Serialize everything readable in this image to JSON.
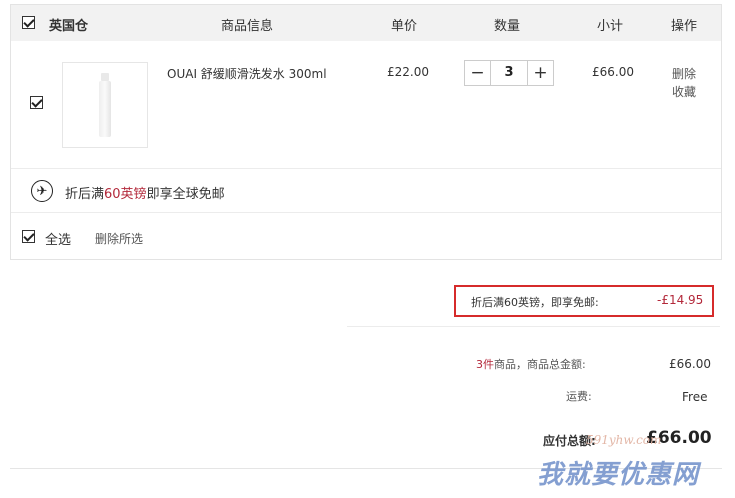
{
  "header": {
    "warehouse": "英国仓",
    "product_info": "商品信息",
    "unit_price": "单价",
    "quantity": "数量",
    "subtotal": "小计",
    "operation": "操作"
  },
  "item": {
    "name": "OUAI 舒缓顺滑洗发水 300ml",
    "unit_price": "£22.00",
    "quantity": "3",
    "subtotal": "£66.00",
    "delete": "删除",
    "favorite": "收藏",
    "checked": true
  },
  "shipping_notice": {
    "prefix": "折后满",
    "highlight": "60英镑",
    "suffix": "即享全球免邮"
  },
  "footer": {
    "select_all": "全选",
    "delete_selected": "删除所选"
  },
  "promo": {
    "label": "折后满60英镑，即享免邮:",
    "value": "-£14.95"
  },
  "summary": {
    "count": "3件",
    "count_suffix": "商品，商品总金额:",
    "goods_total": "£66.00",
    "shipping_label": "运费:",
    "shipping_value": "Free",
    "total_label": "应付总额:",
    "total_value": "£66.00"
  },
  "watermark": {
    "text": "我就要优惠网",
    "url": "591yhw.com"
  },
  "colors": {
    "accent_red": "#b3283a",
    "highlight_border": "#d62b2b",
    "header_bg": "#f2f2f2"
  }
}
